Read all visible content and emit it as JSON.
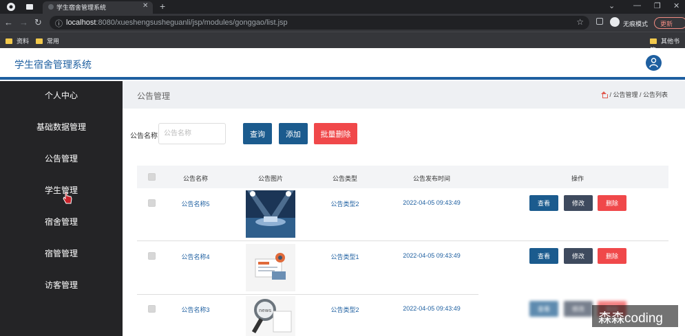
{
  "browser": {
    "tab_title": "学生宿舍管理系统",
    "url_host": "localhost",
    "url_path": ":8080/xueshengsusheguanli/jsp/modules/gonggao/list.jsp",
    "incognito_label": "无痕模式",
    "update_label": "更新",
    "bookmarks": [
      "资料",
      "常用",
      "其他书签"
    ]
  },
  "header": {
    "app_title": "学生宿舍管理系统"
  },
  "sidebar": {
    "items": [
      {
        "label": "个人中心"
      },
      {
        "label": "基础数据管理"
      },
      {
        "label": "公告管理"
      },
      {
        "label": "学生管理"
      },
      {
        "label": "宿舍管理"
      },
      {
        "label": "宿管管理"
      },
      {
        "label": "访客管理"
      }
    ]
  },
  "page": {
    "title": "公告管理",
    "breadcrumb": "/ 公告管理 / 公告列表"
  },
  "search": {
    "label": "公告名称",
    "placeholder": "公告名称",
    "query_label": "查询",
    "add_label": "添加",
    "batch_delete_label": "批量删除"
  },
  "table": {
    "headers": [
      "公告名称",
      "公告图片",
      "公告类型",
      "公告发布时间",
      "操作"
    ],
    "actions": {
      "view": "查看",
      "edit": "修改",
      "delete": "删除"
    },
    "rows": [
      {
        "name": "公告名称5",
        "type": "公告类型2",
        "time": "2022-04-05 09:43:49"
      },
      {
        "name": "公告名称4",
        "type": "公告类型1",
        "time": "2022-04-05 09:43:49"
      },
      {
        "name": "公告名称3",
        "type": "公告类型2",
        "time": "2022-04-05 09:43:49"
      }
    ]
  },
  "watermark": "森森coding"
}
